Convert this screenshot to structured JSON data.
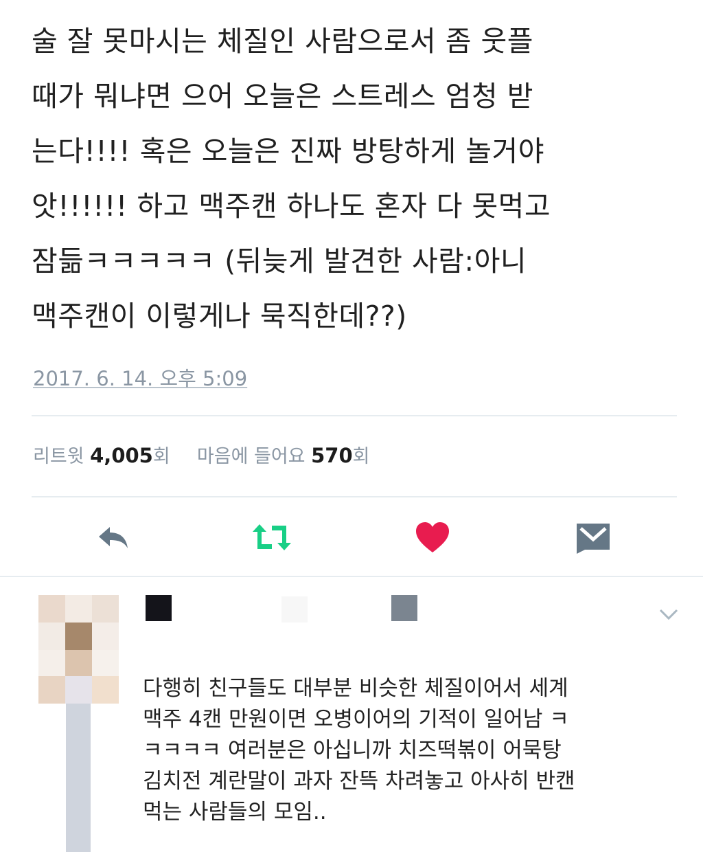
{
  "tweet": {
    "lines": [
      "술 잘 못마시는 체질인 사람으로서 좀 웃플",
      "때가 뭐냐면 으어 오늘은 스트레스 엄청 받",
      "는다!!!! 혹은 오늘은 진짜 방탕하게 놀거야",
      "앗!!!!!! 하고 맥주캔 하나도 혼자 다 못먹고",
      "잠듦ㅋㅋㅋㅋㅋ (뒤늦게 발견한 사람:아니",
      "맥주캔이 이렇게나 묵직한데??)"
    ],
    "timestamp": "2017. 6. 14. 오후 5:09"
  },
  "stats": {
    "retweet_label": "리트윗",
    "retweet_count": "4,005",
    "retweet_unit": "회",
    "like_label": "마음에 들어요",
    "like_count": "570",
    "like_unit": "회"
  },
  "actions": [
    {
      "name": "reply-icon",
      "color": "#657786"
    },
    {
      "name": "retweet-icon",
      "color": "#19cf86"
    },
    {
      "name": "heart-icon",
      "color": "#e81c4f"
    },
    {
      "name": "direct-message-icon",
      "color": "#657786"
    }
  ],
  "reply": {
    "lines": [
      "다행히 친구들도 대부분 비슷한 체질이어서 세계",
      "맥주 4캔 만원이면 오병이어의 기적이 일어남 ㅋ",
      "ㅋㅋㅋㅋ 여러분은 아십니까 치즈떡볶이 어묵탕",
      "김치전 계란말이 과자 잔뜩 차려놓고 아사히 반캔",
      "먹는 사람들의 모임.."
    ]
  },
  "colors": {
    "text": "#202020",
    "muted": "#8a96a3",
    "divider": "#e6ecf0"
  }
}
